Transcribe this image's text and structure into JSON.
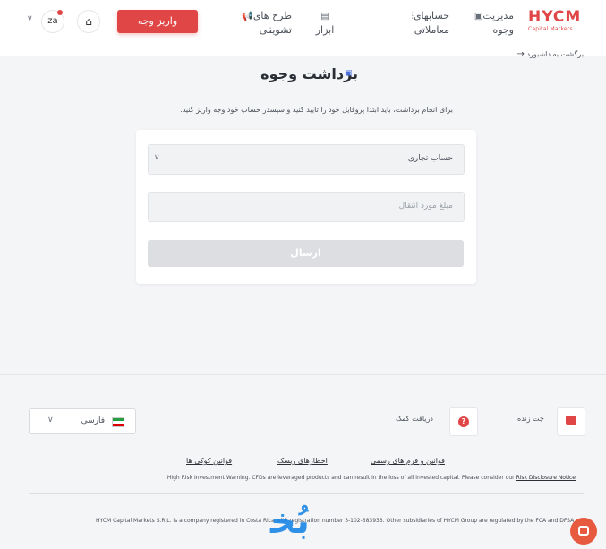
{
  "header": {
    "logo_main": "HYCM",
    "logo_sub": "Capital Markets",
    "nav": [
      {
        "line1": "مدیریت",
        "line2": "وجوه"
      },
      {
        "line1": "حسابهای",
        "line2": "معاملاتی"
      },
      {
        "line1": "",
        "line2": "ابزار"
      },
      {
        "line1": "طرح های",
        "line2": "تشویقی"
      }
    ],
    "deposit_label": "واریز وجه",
    "avatar_initials": "za"
  },
  "main": {
    "back_label": "برگشت به داشبورد",
    "title": "برداشت وجوه",
    "instruction": "برای انجام برداشت، باید ابتدا پروفایل خود را تایید کنید و سپسدر حساب خود وجه واریز کنید.",
    "account_select": "حساب تجاری",
    "amount_placeholder": "مبلغ مورد انتقال",
    "submit_label": "ارسال"
  },
  "footer": {
    "live_chat": "چت زنده",
    "get_help": "دریافت کمک",
    "language": "فارسی",
    "links": [
      "قوانین و فرم های رسمی",
      "اخطارهای ریسک",
      "قوانین کوکی ها"
    ],
    "warning_text": "High Risk Investment Warning. CFDs are leveraged products and can result in the loss of all invested capital. Please consider our",
    "warning_link": "Risk Disclosure Notice",
    "legal_text": "HYCM Capital Markets S.R.L. is a company registered in Costa Rica with registration number 3-102-383933. Other subsidiaries of HYCM Group are regulated by the FCA and DFSA."
  },
  "watermark": "ﺑُﺨ",
  "colors": {
    "brand": "#e04646",
    "background": "#f4f5f7"
  }
}
